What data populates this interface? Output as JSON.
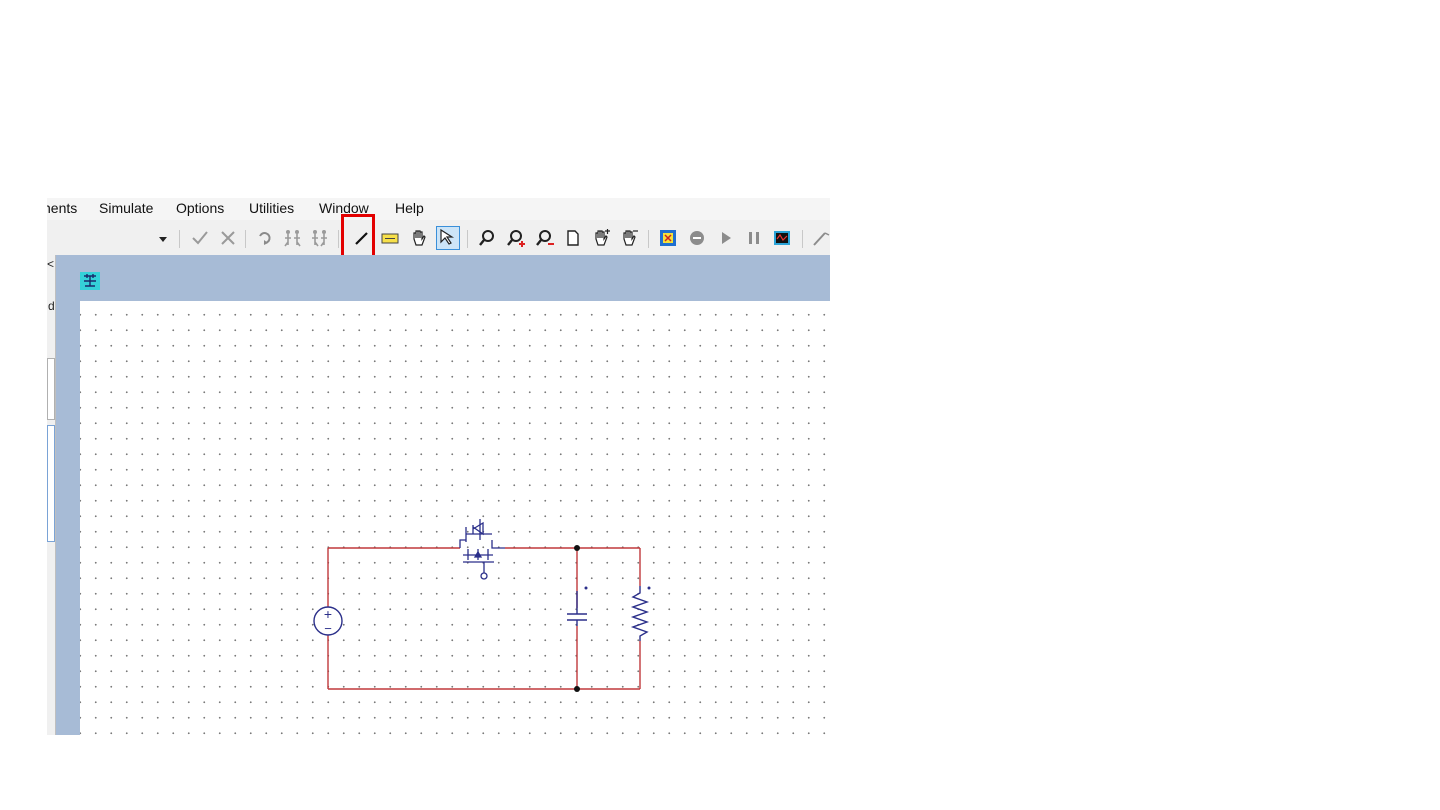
{
  "menu": {
    "items": [
      "nents",
      "Simulate",
      "Options",
      "Utilities",
      "Window",
      "Help"
    ]
  },
  "toolbar": {
    "icons": [
      "dropdown-arrow-icon",
      "checkmark-icon",
      "cross-icon",
      "undo-arrow-icon",
      "netlist-icon-1",
      "netlist-icon-2",
      "wire-pencil-icon",
      "label-tag-icon",
      "hand-icon",
      "select-arrow-icon",
      "zoom-icon",
      "zoom-in-icon",
      "zoom-out-icon",
      "page-icon",
      "pan-hand-icon-1",
      "pan-hand-icon-2",
      "simulate-control-icon",
      "stop-icon",
      "play-icon",
      "pause-icon",
      "scope-icon",
      "probe-icon"
    ],
    "highlight_color": "#e30000"
  },
  "left_panel": {
    "fragments": [
      "<",
      "d"
    ]
  },
  "schematic": {
    "window_icon": "schematic-icon",
    "wire_color": "#c0393b",
    "component_color": "#2b2f8a",
    "background": "#a7bbd6",
    "components": [
      "dc-voltage-source",
      "mosfet-switch",
      "capacitor",
      "resistor"
    ],
    "source_symbols": {
      "plus": "+",
      "minus": "−"
    }
  }
}
